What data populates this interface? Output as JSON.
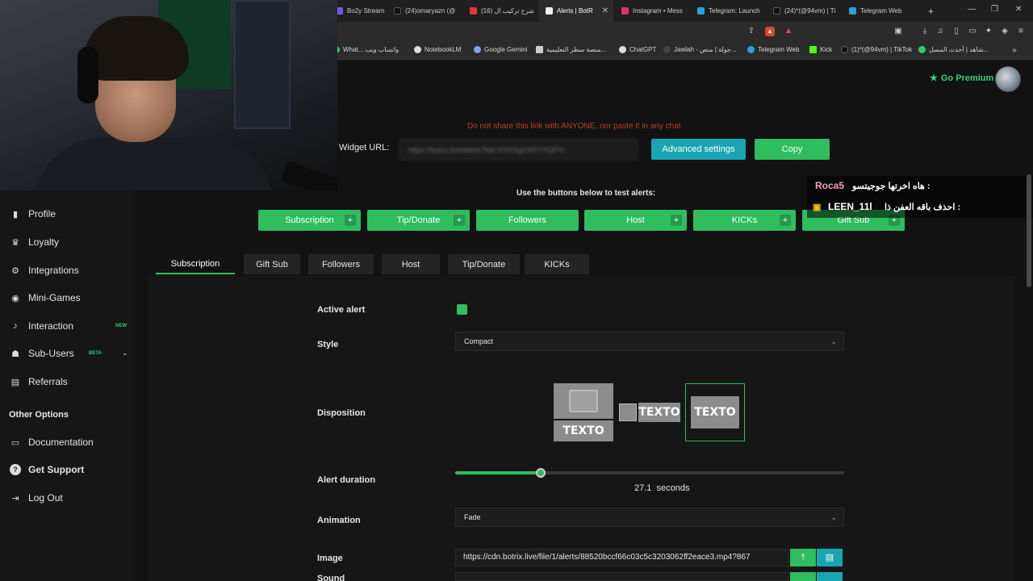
{
  "browser": {
    "tabs": [
      {
        "label": "Bo2y Stream",
        "color": "#6c5ce7",
        "active": false
      },
      {
        "label": "(24)omaryazn (@",
        "color": "#111111",
        "active": false
      },
      {
        "label": "(16) شرح تركيب ال",
        "color": "#e53935",
        "active": false
      },
      {
        "label": "Alerts | BotR",
        "color": "#f1f1f1",
        "active": true
      },
      {
        "label": "Instagram • Mess",
        "color": "#e1306c",
        "active": false
      },
      {
        "label": "Telegram: Launch",
        "color": "#2aa1da",
        "active": false
      },
      {
        "label": "(24)*(@94vm) | Ti",
        "color": "#111111",
        "active": false
      },
      {
        "label": "Telegram Web",
        "color": "#2aa1da",
        "active": false
      }
    ],
    "new_tab": "+",
    "bookmarks": [
      {
        "label": "What... واتساب ويب",
        "color": "#25d366"
      },
      {
        "label": "NotebookLM",
        "color": "#dddddd"
      },
      {
        "label": "Google Gemini",
        "color": "#7aa2f7"
      },
      {
        "label": "منصة سطر التعليمية...",
        "color": "#cccccc"
      },
      {
        "label": "ChatGPT",
        "color": "#dddddd"
      },
      {
        "label": "Jawlah - جولة | منص...",
        "color": "#444444"
      },
      {
        "label": "Telegram Web",
        "color": "#2aa1da"
      },
      {
        "label": "Kick",
        "color": "#53fc18"
      },
      {
        "label": "(1)*(@94vm) | TikTok",
        "color": "#111111"
      },
      {
        "label": "شاهد | أحدث المسل...",
        "color": "#2ecc71"
      }
    ]
  },
  "sidebar": {
    "items": [
      {
        "label": "Profile",
        "icon": "user-icon",
        "glyph": "▮"
      },
      {
        "label": "Loyalty",
        "icon": "trophy-icon",
        "glyph": "🏆"
      },
      {
        "label": "Integrations",
        "icon": "plug-icon",
        "glyph": "⚙"
      },
      {
        "label": "Mini-Games",
        "icon": "gamepad-icon",
        "glyph": "◉"
      },
      {
        "label": "Interaction",
        "icon": "music-icon",
        "glyph": "♪"
      },
      {
        "label": "Sub-Users",
        "icon": "users-icon",
        "glyph": "👥"
      },
      {
        "label": "Referrals",
        "icon": "referral-icon",
        "glyph": "▤"
      }
    ],
    "badge_new": "NEW",
    "badge_beta": "BETA",
    "section_title": "Other Options",
    "other": [
      {
        "label": "Documentation",
        "icon": "document-icon",
        "glyph": "▭"
      },
      {
        "label": "Get Support",
        "icon": "help-icon",
        "glyph": "?"
      },
      {
        "label": "Log Out",
        "icon": "logout-icon",
        "glyph": "⇥"
      }
    ]
  },
  "header": {
    "premium": "Go Premium",
    "warning": "Do not share this link with ANYONE, nor paste it in any chat",
    "widget_label": "Widget URL:",
    "widget_url": "https://botrix.live/alerts?bid=XXXXgCAtTY%2F%",
    "advanced": "Advanced settings",
    "copy": "Copy"
  },
  "test": {
    "label": "Use the buttons below to test alerts:",
    "buttons": [
      {
        "label": "Subscription",
        "plus": true
      },
      {
        "label": "Tip/Donate",
        "plus": true
      },
      {
        "label": "Followers",
        "plus": false
      },
      {
        "label": "Host",
        "plus": true
      },
      {
        "label": "KICKs",
        "plus": true
      },
      {
        "label": "Gift Sub",
        "plus": true
      }
    ]
  },
  "chat": {
    "line1_user": "Roca5",
    "line1_msg": "هاه اخرتها جوجيتسو :",
    "line2_user": "LEEN_11l",
    "line2_msg": "احذف باقه العفن ذا :"
  },
  "alert_tabs": [
    "Subscription",
    "Gift Sub",
    "Followers",
    "Host",
    "Tip/Donate",
    "KICKs"
  ],
  "form": {
    "active_label": "Active alert",
    "style_label": "Style",
    "style_value": "Compact",
    "disposition_label": "Disposition",
    "texto": "TEXTO",
    "duration_label": "Alert duration",
    "duration_value": "27.1",
    "duration_unit": "seconds",
    "duration_fraction": 0.22,
    "animation_label": "Animation",
    "animation_value": "Fade",
    "image_label": "Image",
    "image_url": "https://cdn.botrix.live/file/1/alerts/88520bccf66c03c5c3203062ff2eace3.mp4?867",
    "sound_label": "Sound"
  }
}
